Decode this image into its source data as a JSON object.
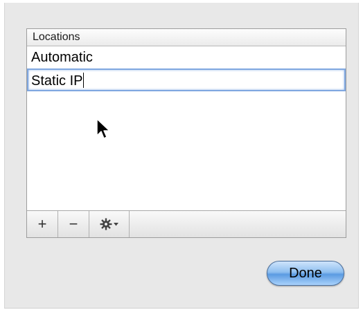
{
  "table": {
    "header": "Locations",
    "rows": [
      "Automatic"
    ],
    "editing_row_value": "Static IP"
  },
  "toolbar": {
    "add_label": "+",
    "remove_label": "−"
  },
  "done_label": "Done",
  "colors": {
    "accent": "#7fa7e0",
    "done_button": "#6aa6e6"
  }
}
